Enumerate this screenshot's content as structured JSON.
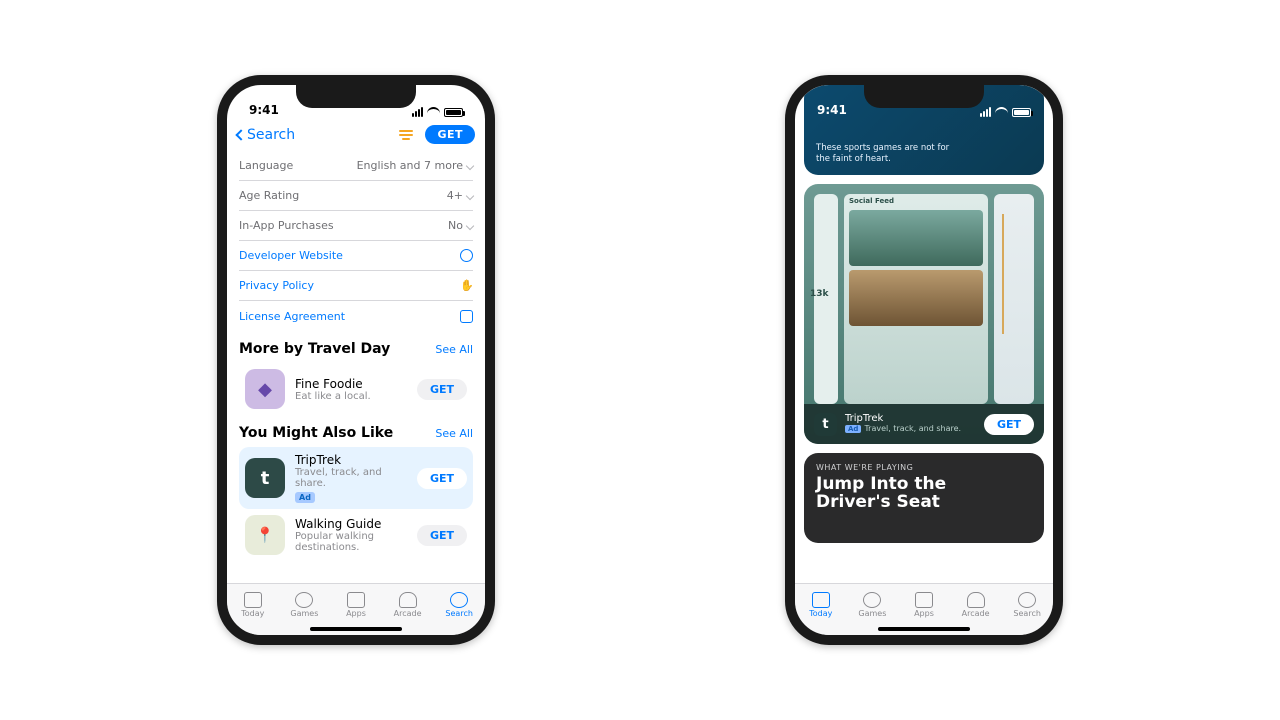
{
  "status": {
    "time": "9:41"
  },
  "phone1": {
    "nav": {
      "back": "Search",
      "action": "GET"
    },
    "info_rows": [
      {
        "label": "Language",
        "value": "English and 7 more"
      },
      {
        "label": "Age Rating",
        "value": "4+"
      },
      {
        "label": "In-App Purchases",
        "value": "No"
      }
    ],
    "link_rows": [
      {
        "label": "Developer Website"
      },
      {
        "label": "Privacy Policy"
      },
      {
        "label": "License Agreement"
      }
    ],
    "more_by": {
      "title": "More by Travel Day",
      "see_all": "See All",
      "apps": [
        {
          "name": "Fine Foodie",
          "sub": "Eat like a local.",
          "get": "GET",
          "bg": "#c9b8e6",
          "glyph": "◆"
        }
      ]
    },
    "ymal": {
      "title": "You Might Also Like",
      "see_all": "See All",
      "apps": [
        {
          "name": "TripTrek",
          "sub": "Travel, track, and share.",
          "get": "GET",
          "ad": "Ad",
          "bg": "#2d4b47",
          "glyph": "t"
        },
        {
          "name": "Walking Guide",
          "sub": "Popular walking destinations.",
          "get": "GET",
          "bg": "#e8ead9",
          "glyph": "📍"
        }
      ]
    }
  },
  "phone2": {
    "hero_caption": "These sports games are not for the faint of heart.",
    "feed_label": "Social Feed",
    "adcard": {
      "name": "TripTrek",
      "sub": "Travel, track, and share.",
      "ad": "Ad",
      "get": "GET"
    },
    "story": {
      "eyebrow": "WHAT WE'RE PLAYING",
      "title_line1": "Jump Into the",
      "title_line2": "Driver's Seat"
    }
  },
  "tabs": [
    {
      "label": "Today"
    },
    {
      "label": "Games"
    },
    {
      "label": "Apps"
    },
    {
      "label": "Arcade"
    },
    {
      "label": "Search"
    }
  ]
}
